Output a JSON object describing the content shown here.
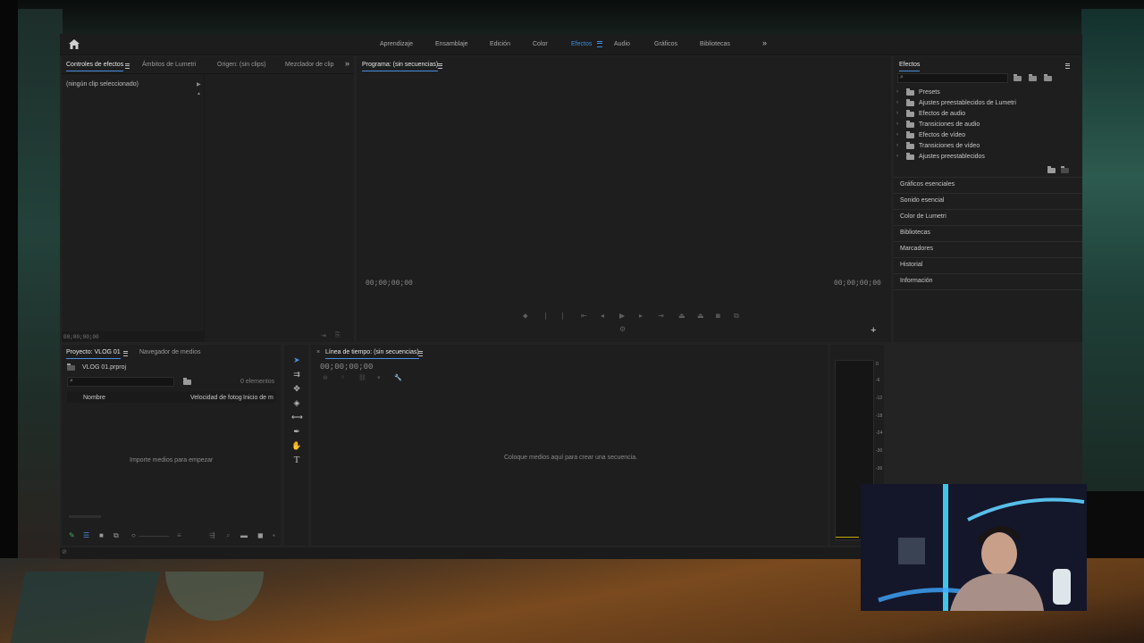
{
  "workspaces": {
    "items": [
      "Aprendizaje",
      "Ensamblaje",
      "Edición",
      "Color",
      "Efectos",
      "Audio",
      "Gráficos",
      "Bibliotecas"
    ],
    "active": "Efectos"
  },
  "source_panel": {
    "tabs": [
      "Controles de efectos",
      "Ámbitos de Lumetri",
      "Origen: (sin clips)",
      "Mezclador de clip"
    ],
    "no_clip": "(ningún clip seleccionado)",
    "timecode": "00;00;00;00"
  },
  "program_monitor": {
    "title": "Programa: (sin secuencias)",
    "timecode_left": "00;00;00;00",
    "timecode_right": "00;00;00;00"
  },
  "effects_panel": {
    "title": "Efectos",
    "folders": [
      "Presets",
      "Ajustes preestablecidos de Lumetri",
      "Efectos de audio",
      "Transiciones de audio",
      "Efectos de vídeo",
      "Transiciones de vídeo",
      "Ajustes preestablecidos"
    ],
    "sections": [
      "Gráficos esenciales",
      "Sonido esencial",
      "Color de Lumetri",
      "Bibliotecas",
      "Marcadores",
      "Historial",
      "Información"
    ]
  },
  "project_panel": {
    "tabs": [
      "Proyecto: VLOG 01",
      "Navegador de medios"
    ],
    "file": "VLOG 01.prproj",
    "count": "0 elementos",
    "columns": [
      "Nombre",
      "Velocidad de fotog",
      "Inicio de m"
    ],
    "empty": "Importe medios para empezar"
  },
  "timeline": {
    "title": "Línea de tiempo: (sin secuencias)",
    "timecode": "00;00;00;00",
    "empty": "Coloque medios aquí para crear una secuencia."
  },
  "audio_meter": {
    "labels": [
      "0",
      "-6",
      "-12",
      "-18",
      "-24",
      "-30",
      "-36"
    ]
  }
}
